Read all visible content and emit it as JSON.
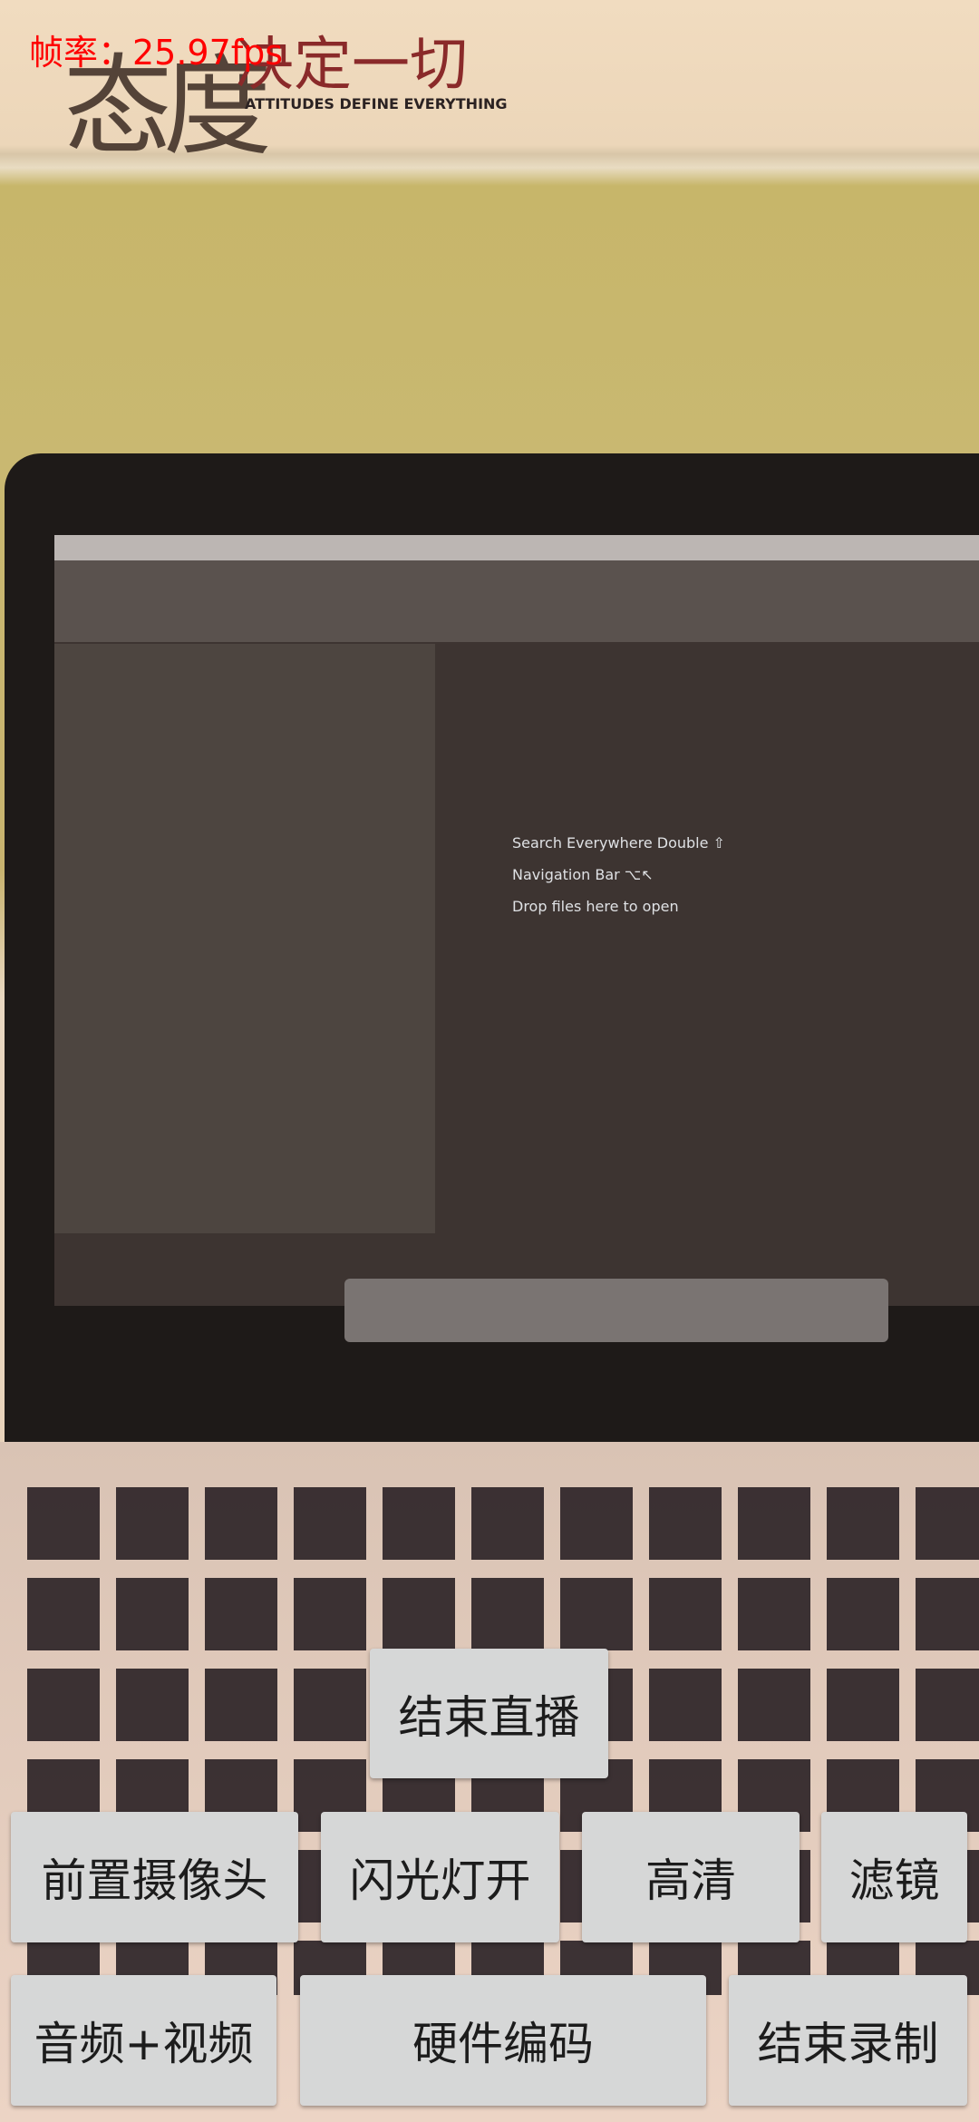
{
  "overlay": {
    "fps_label": "帧率：25.97fps"
  },
  "background_scene": {
    "sign_text": "态度决定一切",
    "sign_subtitle": "ATTITUDES DEFINE EVERYTHING",
    "screen_hints": [
      "Search Everywhere Double ⇧",
      "Navigation Bar ⌥↖",
      "Drop files here to open"
    ]
  },
  "buttons": {
    "end_live": "结束直播",
    "front_camera": "前置摄像头",
    "flash_on": "闪光灯开",
    "hd": "高清",
    "filter": "滤镜",
    "audio_video": "音频+视频",
    "hardware_encode": "硬件编码",
    "end_record": "结束录制"
  },
  "colors": {
    "fps": "#ff0000",
    "button_bg": "#d6d7d7",
    "button_text": "#1c1c1c"
  }
}
